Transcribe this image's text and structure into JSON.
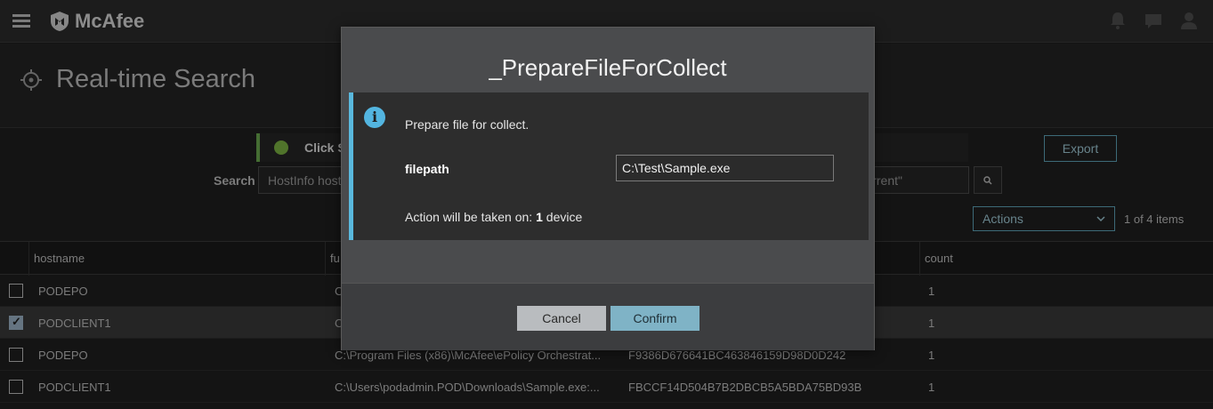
{
  "app": {
    "brand": "McAfee",
    "page_title": "Real-time Search"
  },
  "notice": {
    "text": "Click S"
  },
  "toolbar": {
    "export_label": "Export",
    "search_label": "Search",
    "search_value": "HostInfo host",
    "search_value_tail": "rrent\"",
    "actions_label": "Actions",
    "items_count": "1 of 4 items"
  },
  "table": {
    "columns": [
      "hostname",
      "fu",
      "count"
    ],
    "rows": [
      {
        "hostname": "PODEPO",
        "path": "C",
        "hash": "",
        "count": "1",
        "checked": false
      },
      {
        "hostname": "PODCLIENT1",
        "path": "C",
        "hash": "",
        "count": "1",
        "checked": true
      },
      {
        "hostname": "PODEPO",
        "path": "C:\\Program Files (x86)\\McAfee\\ePolicy Orchestrat...",
        "hash": "F9386D676641BC463846159D98D0D242",
        "count": "1",
        "checked": false
      },
      {
        "hostname": "PODCLIENT1",
        "path": "C:\\Users\\podadmin.POD\\Downloads\\Sample.exe:...",
        "hash": "FBCCF14D504B7B2DBCB5A5BDA75BD93B",
        "count": "1",
        "checked": false
      }
    ]
  },
  "modal": {
    "title": "_PrepareFileForCollect",
    "message": "Prepare file for collect.",
    "field_label": "filepath",
    "field_value": "C:\\Test\\Sample.exe",
    "action_prefix": "Action will be taken on: ",
    "action_count": "1",
    "action_suffix": " device",
    "cancel_label": "Cancel",
    "confirm_label": "Confirm"
  },
  "colors": {
    "accent": "#59b8dd",
    "confirm": "#7fb3c6",
    "success": "#7cb342"
  },
  "icons": [
    "hamburger-icon",
    "mcafee-shield-icon",
    "bell-icon",
    "chat-icon",
    "user-icon",
    "target-icon",
    "check-circle-icon",
    "search-icon",
    "chevron-down-icon",
    "info-icon"
  ]
}
